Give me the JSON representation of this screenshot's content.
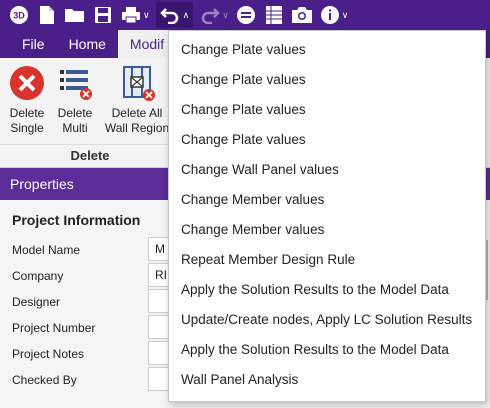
{
  "qat": {
    "app_icon_text": "3D",
    "icons": [
      "app-icon",
      "new-file-icon",
      "open-folder-icon",
      "save-icon",
      "print-icon",
      "undo-icon",
      "redo-icon",
      "minus-circle-icon",
      "table-icon",
      "camera-icon",
      "info-icon"
    ]
  },
  "tabs": [
    {
      "label": "File"
    },
    {
      "label": "Home"
    },
    {
      "label": "Modif"
    }
  ],
  "ribbon": {
    "buttons": [
      {
        "label": "Delete\nSingle"
      },
      {
        "label": "Delete\nMulti"
      },
      {
        "label": "Delete All\nWall Region"
      }
    ],
    "group_label": "Delete"
  },
  "properties": {
    "header": "Properties",
    "section_title": "Project Information",
    "rows": [
      {
        "label": "Model Name",
        "value": "M"
      },
      {
        "label": "Company",
        "value": "RI"
      },
      {
        "label": "Designer",
        "value": ""
      },
      {
        "label": "Project Number",
        "value": ""
      },
      {
        "label": "Project Notes",
        "value": ""
      },
      {
        "label": "Checked By",
        "value": ""
      }
    ]
  },
  "undo_menu": {
    "items": [
      "Change Plate values",
      "Change Plate values",
      "Change Plate values",
      "Change Plate values",
      "Change Wall Panel values",
      "Change Member values",
      "Change Member values",
      "Repeat Member Design Rule",
      "Apply the Solution Results to the Model Data",
      "Update/Create nodes, Apply LC Solution Results",
      "Apply the Solution Results to the Model Data",
      "Wall Panel Analysis"
    ]
  },
  "colors": {
    "brand_purple": "#4b1f8a",
    "panel_header": "#5b2c9a",
    "delete_red": "#d9342b"
  }
}
